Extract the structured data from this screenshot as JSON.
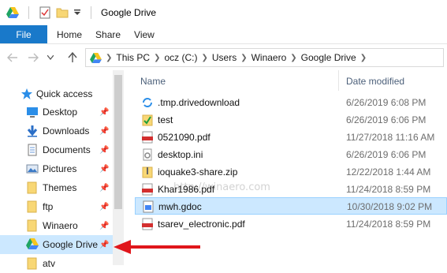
{
  "window": {
    "title": "Google Drive",
    "accent": "#1979ca"
  },
  "ribbon": {
    "tabs": [
      {
        "label": "File"
      },
      {
        "label": "Home"
      },
      {
        "label": "Share"
      },
      {
        "label": "View"
      }
    ]
  },
  "address": {
    "crumbs": [
      "This PC",
      "ocz (C:)",
      "Users",
      "Winaero",
      "Google Drive"
    ]
  },
  "sidebar": {
    "items": [
      {
        "label": "Quick access",
        "icon": "star-icon"
      },
      {
        "label": "Desktop",
        "icon": "desktop-icon"
      },
      {
        "label": "Downloads",
        "icon": "download-icon"
      },
      {
        "label": "Documents",
        "icon": "documents-icon"
      },
      {
        "label": "Pictures",
        "icon": "pictures-icon"
      },
      {
        "label": "Themes",
        "icon": "folder-icon"
      },
      {
        "label": "ftp",
        "icon": "folder-icon"
      },
      {
        "label": "Winaero",
        "icon": "folder-icon"
      },
      {
        "label": "Google Drive",
        "icon": "google-drive-icon"
      },
      {
        "label": "atv",
        "icon": "folder-icon"
      }
    ]
  },
  "files": {
    "headers": {
      "name": "Name",
      "date": "Date modified"
    },
    "rows": [
      {
        "name": ".tmp.drivedownload",
        "date": "6/26/2019 6:08 PM",
        "icon": "sync-folder-icon"
      },
      {
        "name": "test",
        "date": "6/26/2019 6:06 PM",
        "icon": "checked-folder-icon"
      },
      {
        "name": "0521090.pdf",
        "date": "11/27/2018 11:16 AM",
        "icon": "pdf-icon"
      },
      {
        "name": "desktop.ini",
        "date": "6/26/2019 6:06 PM",
        "icon": "ini-file-icon"
      },
      {
        "name": "ioquake3-share.zip",
        "date": "12/22/2018 1:44 AM",
        "icon": "zip-icon"
      },
      {
        "name": "Khar1986.pdf",
        "date": "11/24/2018 8:59 PM",
        "icon": "pdf-icon"
      },
      {
        "name": "mwh.gdoc",
        "date": "10/30/2018 9:02 PM",
        "icon": "gdoc-icon"
      },
      {
        "name": "tsarev_electronic.pdf",
        "date": "11/24/2018 8:59 PM",
        "icon": "pdf-icon"
      }
    ]
  },
  "watermark": "http://winaero.com"
}
